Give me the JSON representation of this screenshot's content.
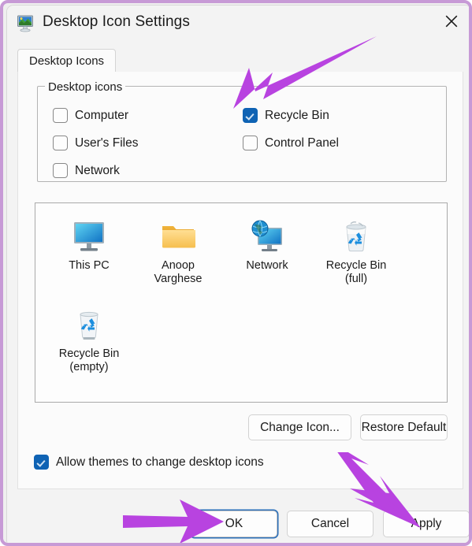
{
  "window": {
    "title": "Desktop Icon Settings",
    "icon": "desktop-monitor-icon",
    "close_label": "✕"
  },
  "tabs": [
    {
      "label": "Desktop Icons",
      "selected": true
    }
  ],
  "group": {
    "legend": "Desktop icons",
    "checkboxes": [
      {
        "label": "Computer",
        "checked": false,
        "col": 0,
        "row": 0
      },
      {
        "label": "User's Files",
        "checked": false,
        "col": 0,
        "row": 1
      },
      {
        "label": "Network",
        "checked": false,
        "col": 0,
        "row": 2
      },
      {
        "label": "Recycle Bin",
        "checked": true,
        "col": 1,
        "row": 0
      },
      {
        "label": "Control Panel",
        "checked": false,
        "col": 1,
        "row": 1
      }
    ]
  },
  "preview": {
    "items": [
      {
        "label": "This PC",
        "label2": "",
        "icon": "monitor-icon"
      },
      {
        "label": "Anoop",
        "label2": "Varghese",
        "icon": "folder-icon"
      },
      {
        "label": "Network",
        "label2": "",
        "icon": "network-globe-icon"
      },
      {
        "label": "Recycle Bin",
        "label2": "(full)",
        "icon": "recycle-bin-full-icon"
      },
      {
        "label": "Recycle Bin",
        "label2": "(empty)",
        "icon": "recycle-bin-empty-icon"
      }
    ]
  },
  "icon_actions": {
    "change_icon": "Change Icon...",
    "restore_default": "Restore Default"
  },
  "allow_themes": {
    "label": "Allow themes to change desktop icons",
    "checked": true
  },
  "footer": {
    "ok": "OK",
    "cancel": "Cancel",
    "apply": "Apply"
  },
  "annotations": {
    "arrow_color": "#b843e0",
    "arrows": [
      {
        "name": "arrow-to-recycle-bin-checkbox",
        "target": "Recycle Bin checkbox"
      },
      {
        "name": "arrow-to-ok-button",
        "target": "OK button"
      },
      {
        "name": "arrow-to-apply-button",
        "target": "Apply button"
      }
    ]
  },
  "colors": {
    "dialog_bg": "#f3f3f3",
    "page_bg": "#fbfbfb",
    "accent_blue": "#0f63b4",
    "focus_ring": "#2a6fba",
    "arrow_purple": "#b843e0",
    "text": "#1b1b1b"
  }
}
